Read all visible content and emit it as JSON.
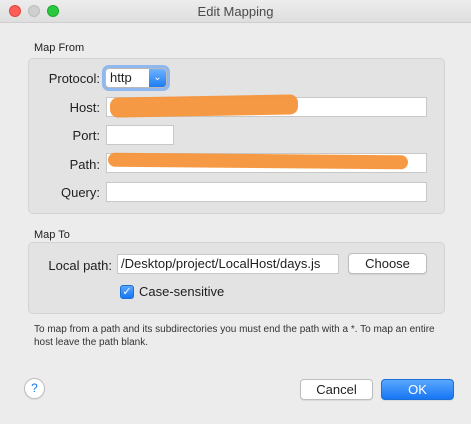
{
  "window": {
    "title": "Edit Mapping"
  },
  "map_from": {
    "heading": "Map From",
    "protocol": {
      "label": "Protocol:",
      "value": "http",
      "arrow_icon": "chevron-updown-icon"
    },
    "host": {
      "label": "Host:",
      "value": ""
    },
    "port": {
      "label": "Port:",
      "value": ""
    },
    "path": {
      "label": "Path:",
      "value": ""
    },
    "query": {
      "label": "Query:",
      "value": ""
    }
  },
  "map_to": {
    "heading": "Map To",
    "local_path": {
      "label": "Local path:",
      "value": "/Desktop/project/LocalHost/days.js"
    },
    "choose_button": "Choose",
    "case_sensitive": {
      "label": "Case-sensitive",
      "checked": true
    }
  },
  "help_text": "To map from a path and its subdirectories you must end the path with a *. To map an entire host leave the path blank.",
  "buttons": {
    "help": "?",
    "cancel": "Cancel",
    "ok": "OK"
  },
  "colors": {
    "accent": "#1676f3",
    "redaction": "#f5933a"
  }
}
